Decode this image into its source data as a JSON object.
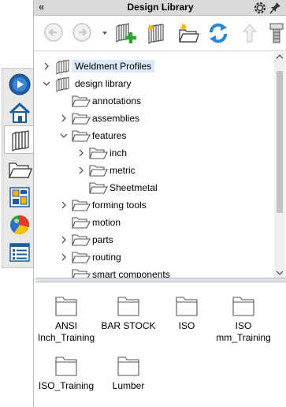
{
  "pane": {
    "title": "Design Library",
    "collapse_glyph": "«"
  },
  "left_tabs": [
    {
      "name": "solidworks-resources-tab",
      "icon": "solidworks-resources-icon"
    },
    {
      "name": "design-library-home-tab",
      "icon": "home-icon"
    },
    {
      "name": "design-library-tab",
      "icon": "design-library-icon",
      "active": true
    },
    {
      "name": "file-explorer-tab",
      "icon": "open-folder-icon"
    },
    {
      "name": "view-palette-tab",
      "icon": "view-palette-icon"
    },
    {
      "name": "appearances-tab",
      "icon": "appearances-icon"
    },
    {
      "name": "custom-properties-tab",
      "icon": "custom-properties-icon"
    }
  ],
  "toolbar": {
    "buttons": [
      "back-icon",
      "forward-icon",
      "history-dropdown-icon",
      "add-to-library-icon",
      "add-file-location-icon",
      "create-new-folder-icon",
      "refresh-icon",
      "up-one-level-icon",
      "generate-toolbox-icon"
    ]
  },
  "tree": [
    {
      "label": "Weldment Profiles",
      "expander": "collapsed",
      "level": 0,
      "icon": "library",
      "selected": true
    },
    {
      "label": "design library",
      "expander": "expanded",
      "level": 0,
      "icon": "library"
    },
    {
      "label": "annotations",
      "expander": "none",
      "level": 1,
      "icon": "folder"
    },
    {
      "label": "assemblies",
      "expander": "collapsed",
      "level": 1,
      "icon": "folder"
    },
    {
      "label": "features",
      "expander": "expanded",
      "level": 1,
      "icon": "folder"
    },
    {
      "label": "inch",
      "expander": "collapsed",
      "level": 2,
      "icon": "folder"
    },
    {
      "label": "metric",
      "expander": "collapsed",
      "level": 2,
      "icon": "folder"
    },
    {
      "label": "Sheetmetal",
      "expander": "none",
      "level": 2,
      "icon": "folder"
    },
    {
      "label": "forming tools",
      "expander": "collapsed",
      "level": 1,
      "icon": "folder"
    },
    {
      "label": "motion",
      "expander": "none",
      "level": 1,
      "icon": "folder"
    },
    {
      "label": "parts",
      "expander": "collapsed",
      "level": 1,
      "icon": "folder"
    },
    {
      "label": "routing",
      "expander": "collapsed",
      "level": 1,
      "icon": "folder"
    },
    {
      "label": "smart components",
      "expander": "none",
      "level": 1,
      "icon": "folder"
    }
  ],
  "files": [
    {
      "line1": "ANSI",
      "line2": "Inch_Training"
    },
    {
      "line1": "BAR STOCK",
      "line2": ""
    },
    {
      "line1": "ISO",
      "line2": ""
    },
    {
      "line1": "ISO",
      "line2": "mm_Training"
    },
    {
      "line1": "ISO_Training",
      "line2": ""
    },
    {
      "line1": "Lumber",
      "line2": ""
    }
  ],
  "colors": {
    "selection": "#dbe9f8",
    "refresh": "#2a86d6",
    "add_green": "#2aa62a",
    "folder_outline": "#555555"
  }
}
